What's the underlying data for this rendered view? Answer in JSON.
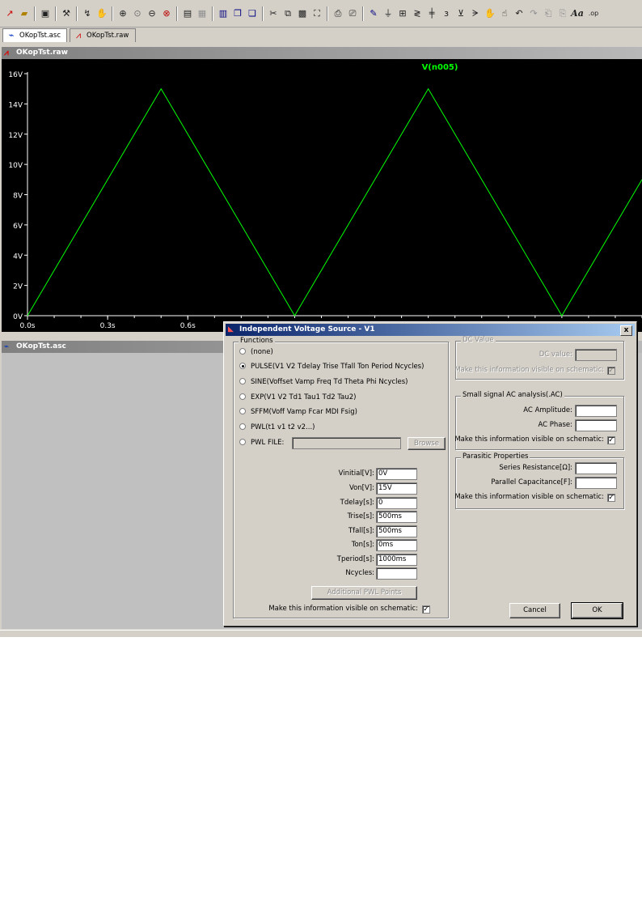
{
  "tabs": [
    {
      "label": "OKopTst.asc",
      "icon": "schematic-icon"
    },
    {
      "label": "OKopTst.raw",
      "icon": "waveform-icon"
    }
  ],
  "plot_window": {
    "title": "OKopTst.raw",
    "trace_label": "V(n005)",
    "trace_color": "#00ff00",
    "y_tick_labels": [
      "16V",
      "14V",
      "12V",
      "10V",
      "8V",
      "6V",
      "4V",
      "2V",
      "0V"
    ],
    "x_tick_labels": [
      "0.0s",
      "0.3s",
      "0.6s"
    ]
  },
  "chart_data": {
    "type": "line",
    "title": "",
    "xlabel": "",
    "ylabel": "",
    "xlim": [
      0,
      2.3
    ],
    "ylim": [
      0,
      16
    ],
    "series": [
      {
        "name": "V(n005)",
        "x": [
          0,
          0.5,
          1.0,
          1.5,
          2.0,
          2.3
        ],
        "y": [
          0,
          15,
          0,
          15,
          0,
          9
        ]
      }
    ],
    "grid": false
  },
  "schematic_window": {
    "title": "OKopTst.asc"
  },
  "dialog": {
    "title": "Independent Voltage Source - V1",
    "close_label": "x",
    "functions_label": "Functions",
    "functions": [
      {
        "label": "(none)",
        "selected": false
      },
      {
        "label": "PULSE(V1 V2 Tdelay Trise Tfall Ton Period Ncycles)",
        "selected": true
      },
      {
        "label": "SINE(Voffset Vamp Freq Td Theta Phi Ncycles)",
        "selected": false
      },
      {
        "label": "EXP(V1 V2 Td1 Tau1 Td2 Tau2)",
        "selected": false
      },
      {
        "label": "SFFM(Voff Vamp Fcar MDI Fsig)",
        "selected": false
      },
      {
        "label": "PWL(t1 v1 t2 v2...)",
        "selected": false
      },
      {
        "label": "PWL FILE:",
        "selected": false
      }
    ],
    "pwl_file_value": "",
    "browse_label": "Browse",
    "params": [
      {
        "label": "Vinitial[V]:",
        "value": "0V"
      },
      {
        "label": "Von[V]:",
        "value": "15V"
      },
      {
        "label": "Tdelay[s]:",
        "value": "0"
      },
      {
        "label": "Trise[s]:",
        "value": "500ms"
      },
      {
        "label": "Tfall[s]:",
        "value": "500ms"
      },
      {
        "label": "Ton[s]:",
        "value": "0ms"
      },
      {
        "label": "Tperiod[s]:",
        "value": "1000ms"
      },
      {
        "label": "Ncycles:",
        "value": ""
      }
    ],
    "additional_pwl_label": "Additional PWL Points",
    "visible_left_label": "Make this information visible on schematic:",
    "visible_left_checked": "✓",
    "dc": {
      "group_label": "DC Value",
      "value_label": "DC value:",
      "value": "",
      "visible_label": "Make this information visible on schematic:",
      "checked": "✓"
    },
    "ac": {
      "group_label": "Small signal AC analysis(.AC)",
      "amplitude_label": "AC Amplitude:",
      "amplitude": "",
      "phase_label": "AC Phase:",
      "phase": "",
      "visible_label": "Make this information visible on schematic:",
      "checked": "✓"
    },
    "parasitic": {
      "group_label": "Parasitic Properties",
      "series_label": "Series Resistance[Ω]:",
      "series": "",
      "parallel_label": "Parallel Capacitance[F]:",
      "parallel": "",
      "visible_label": "Make this information visible on schematic:",
      "checked": "✓"
    },
    "cancel_label": "Cancel",
    "ok_label": "OK"
  }
}
